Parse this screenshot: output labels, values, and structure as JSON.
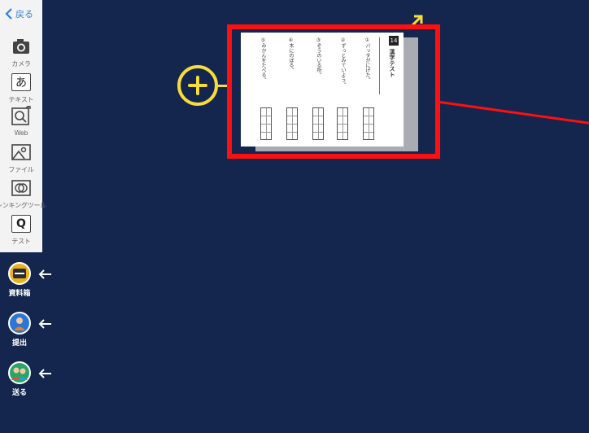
{
  "sidebar": {
    "back_label": "戻る",
    "tools": [
      {
        "label": "カメラ",
        "icon": "camera-icon"
      },
      {
        "label": "テキスト",
        "icon": "text-icon",
        "glyph": "あ"
      },
      {
        "label": "Web",
        "icon": "web-search-icon"
      },
      {
        "label": "ファイル",
        "icon": "image-file-icon"
      },
      {
        "label": "シンキングツール",
        "icon": "thinking-tool-icon"
      },
      {
        "label": "テスト",
        "icon": "test-icon",
        "glyph": "Q"
      }
    ]
  },
  "actions": [
    {
      "label": "資料箱",
      "icon": "material-box-icon",
      "color": "#e8b21f"
    },
    {
      "label": "提出",
      "icon": "submit-icon",
      "color": "#2e76d6"
    },
    {
      "label": "送る",
      "icon": "send-icon",
      "color": "#2aa56a"
    }
  ],
  "card": {
    "badge": "14",
    "title": "漢字テスト",
    "questions": [
      "①バッタがにげた。",
      "②ずっとみていよう。",
      "③ぞうのいる所。",
      "④木にのぼる。",
      "⑤みかんをたべる。"
    ]
  },
  "colors": {
    "background": "#14264d",
    "highlight": "#ff1010",
    "accent": "#f7dd3b",
    "link": "#2f7fe0"
  }
}
